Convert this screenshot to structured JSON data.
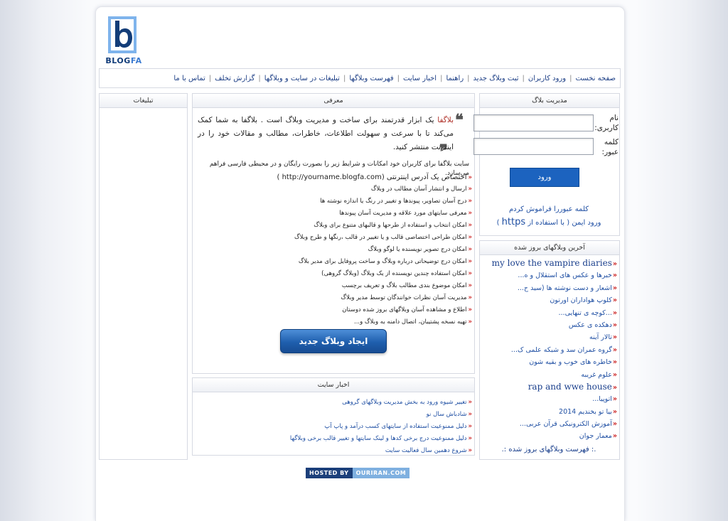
{
  "logo": {
    "word_main": "BLOG",
    "word_accent": "FA"
  },
  "nav": [
    "صفحه نخست",
    "ورود کاربران",
    "ثبت وبلاگ جدید",
    "راهنما",
    "اخبار سایت",
    "فهرست وبلاگها",
    "تبلیغات در سایت و وبلاگها",
    "گزارش تخلف",
    "تماس با ما"
  ],
  "sep": "|",
  "ads": {
    "title": "تبلیغات"
  },
  "intro": {
    "title": "معرفی",
    "brand": "بلاگفا",
    "text": " یک ابزار قدرتمند برای ساخت و مدیریت وبلاگ است . بلاگفا به شما کمک می‌کند تا با سرعت و سهولت اطلاعات، خاطرات، مطالب و مقالات خود را در اینترنت منتشر کنید.",
    "sub": "سایت بلاگفا برای کاربران خود امکانات و شرایط زیر را بصورت رایگان و در محیطی فارسی فراهم می‌سازد.",
    "url_line": "اختصاص یک آدرس اینترنتی (http://yourname.blogfa.com )",
    "features": [
      "ارسال و انتشار آسان مطالب در وبلاگ",
      "درج آسان تصاویر، پیوندها و تغییر در رنگ یا اندازه نوشته ها",
      "معرفی سایتهای مورد علاقه و مدیریت آسان پیوندها",
      "امکان انتخاب و استفاده از طرحها و قالبهای متنوع برای وبلاگ",
      "امکان طراحی اختصاصی قالب و یا تغییر در قالب ،رنگها و طرح وبلاگ",
      "امکان درج تصویر نویسنده یا لوگو وبلاگ",
      "امکان درج توضیحاتی درباره وبلاگ و ساخت پروفایل برای مدیر بلاگ",
      "امکان استفاده چندین نویسنده از یک وبلاگ (وبلاگ گروهی)",
      "امکان موضوع بندی مطالب بلاگ و تعریف برچسب",
      "مدیریت آسان نظرات خوانندگان توسط مدیر وبلاگ",
      "اطلاع و مشاهده آسان وبلاگهای بروز شده دوستان",
      "تهیه نسخه پشتیبان، اتصال دامنه به وبلاگ و..."
    ],
    "create_button": "ایجاد وبلاگ جدید"
  },
  "news": {
    "title": "اخبار سایت",
    "items": [
      "تغییر شیوه ورود به بخش مدیریت وبلاگهای گروهی",
      "شادباش سال نو",
      "دلیل ممنوعیت استفاده از سایتهای کسب درآمد و پاپ آپ",
      "دلیل ممنوعیت درج برخی کدها و لینک سایتها و تغییر قالب برخی وبلاگها",
      "شروع دهمین سال فعالیت سایت"
    ]
  },
  "login": {
    "title": "مدیریت بلاگ",
    "username_label": "نام کاربری:",
    "password_label": "کلمه عبور:",
    "username_value": "",
    "password_value": "",
    "submit": "ورود",
    "forgot": "کلمه عبوررا فراموش کردم",
    "secure_pre": "ورود ایمن ( با استفاده از ",
    "secure_https": "https",
    "secure_post": " )"
  },
  "latest": {
    "title": "آخرین وبلاگهای بروز شده",
    "items": [
      "my love the vampire diaries",
      "خبرها و عکس های استقلال و ه...",
      "اشعار و دست نوشته ها (سید ح...",
      "کلوپ هواداران اورتون",
      "...کوچه ی تنهایی...",
      "دهکده ی عکس",
      "تالار آینه",
      "گروه عمران سد و شبکه علمی ک...",
      "خاطره های خوب و بقیه شون",
      "علوم غریبه",
      "rap and wwe house",
      "اتوپیا...",
      "بیا تو بخندیم 2014",
      "آموزش الکترونیکی قرآن عربی...",
      "معمار جوان"
    ],
    "all": ".: فهرست وبلاگهای بروز شده :."
  },
  "hosted": {
    "a": "HOSTED BY",
    "b": "OURIRAN.COM"
  }
}
